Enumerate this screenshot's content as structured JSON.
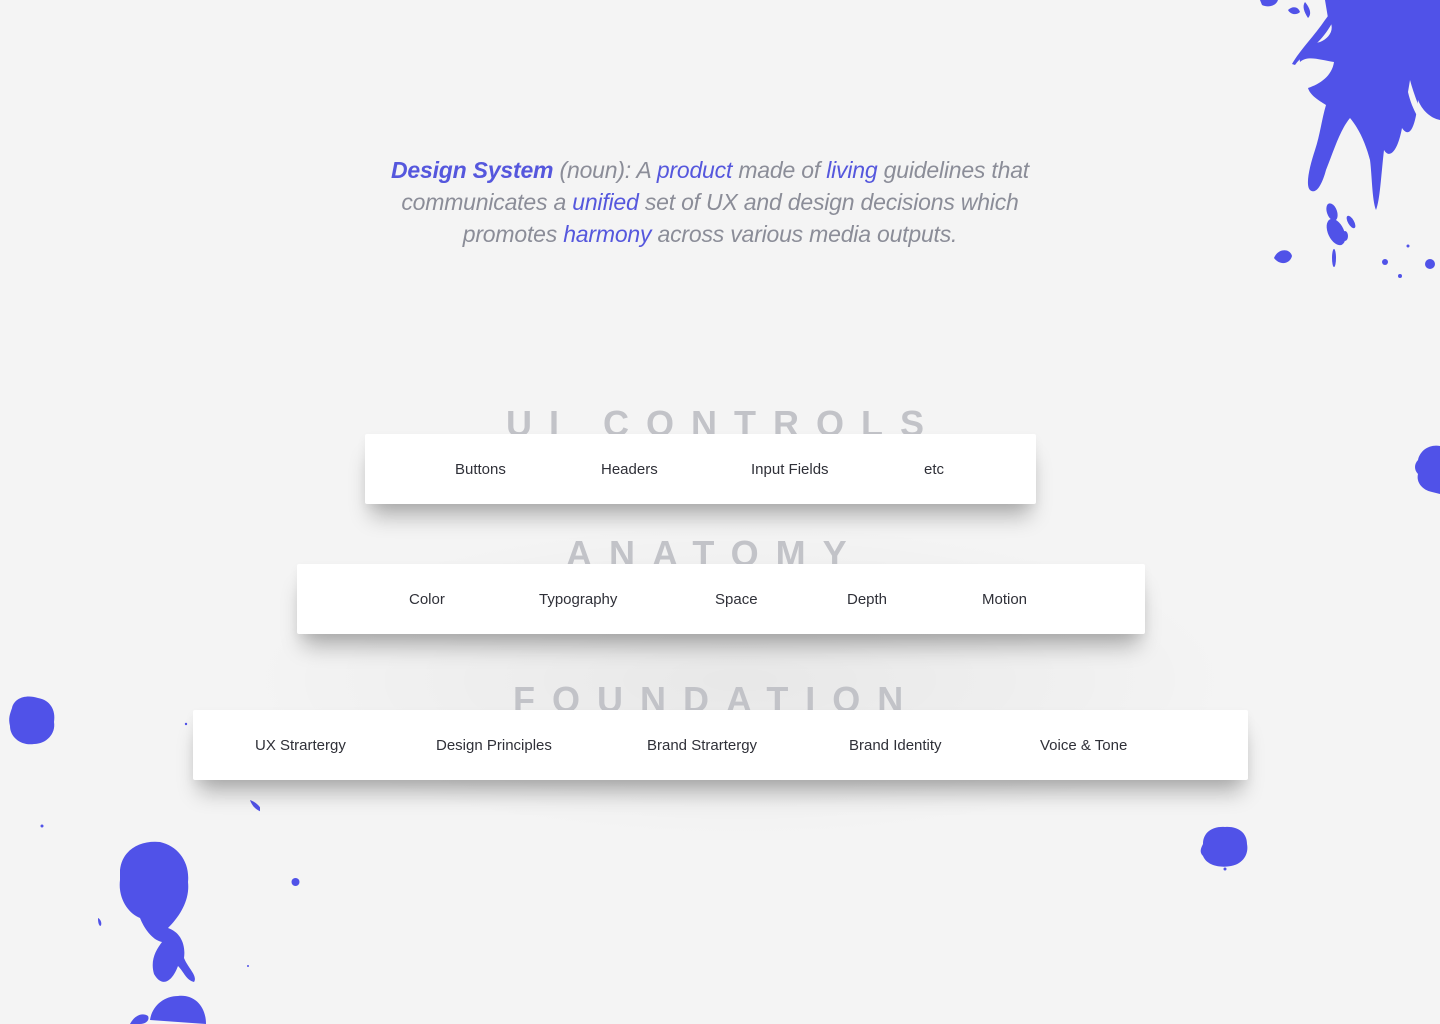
{
  "definition": {
    "term": "Design System",
    "part1": " (noun): A ",
    "word_product": "product",
    "part2": " made of ",
    "word_living": "living",
    "part3": " guidelines that communicates a ",
    "word_unified": "unified",
    "part4": " set of UX and design decisions which promotes ",
    "word_harmony": "harmony",
    "part5": " across various media outputs."
  },
  "layers": {
    "ui_controls": {
      "title": "UI CONTROLS",
      "items": [
        "Buttons",
        "Headers",
        "Input Fields",
        "etc"
      ]
    },
    "anatomy": {
      "title": "ANATOMY",
      "items": [
        "Color",
        "Typography",
        "Space",
        "Depth",
        "Motion"
      ]
    },
    "foundation": {
      "title": "FOUNDATION",
      "items": [
        "UX Strartergy",
        "Design Principles",
        "Brand Strartergy",
        "Brand Identity",
        "Voice & Tone"
      ]
    }
  },
  "colors": {
    "accent": "#5557dd",
    "text_muted": "#8b8d98",
    "layer_title": "#c2c3c8",
    "splatter": "#5052e8",
    "background": "#f4f4f4"
  },
  "icons": [
    "ink-splatter-icon"
  ]
}
